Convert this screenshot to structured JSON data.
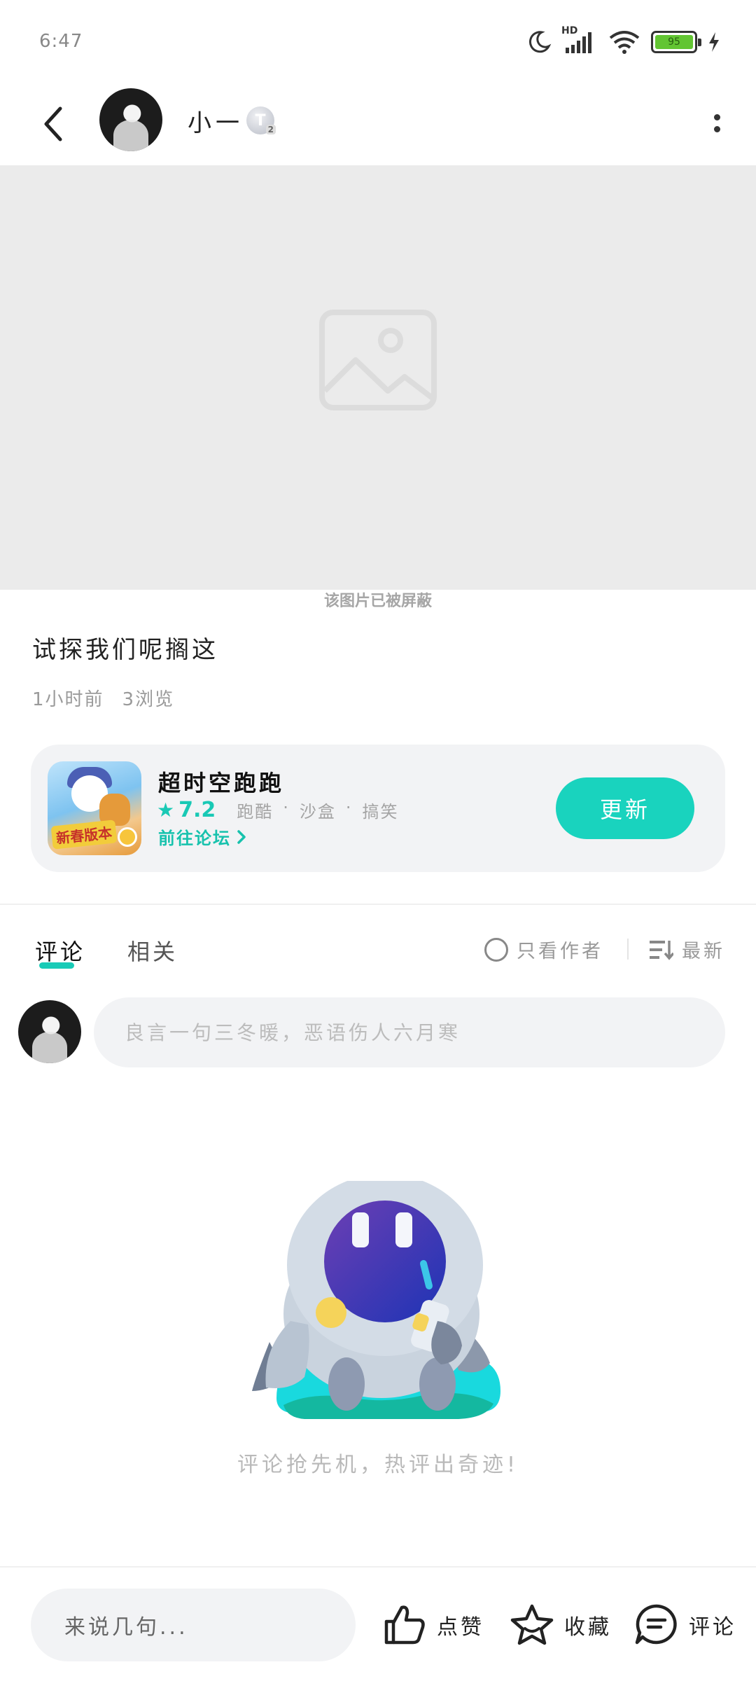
{
  "status_bar": {
    "time": "6:47",
    "network_label": "HD",
    "battery_level": "95"
  },
  "header": {
    "user_name": "小一",
    "level_badge": "T",
    "level_sub": "2"
  },
  "media": {
    "blocked_text": "该图片已被屏蔽"
  },
  "post": {
    "title": "试探我们呢搁这",
    "time_ago": "1小时前",
    "views": "3浏览"
  },
  "game_card": {
    "name": "超时空跑跑",
    "rating": "7.2",
    "tags": [
      "跑酷",
      "·",
      "沙盒",
      "·",
      "搞笑"
    ],
    "forum_link": "前往论坛",
    "update_button": "更新",
    "icon_badge": "新春版本"
  },
  "tabs": [
    {
      "label": "评论",
      "active": true
    },
    {
      "label": "相关",
      "active": false
    }
  ],
  "filters": {
    "author_only": "只看作者",
    "sort": "最新"
  },
  "comment_box": {
    "placeholder": "良言一句三冬暖，恶语伤人六月寒"
  },
  "empty_state": {
    "message": "评论抢先机，热评出奇迹!"
  },
  "bottom_bar": {
    "input_placeholder": "来说几句...",
    "like_label": "点赞",
    "favorite_label": "收藏",
    "comment_label": "评论"
  },
  "colors": {
    "accent": "#19d3be",
    "accent_text": "#17c2ad",
    "card_bg": "#f2f3f5",
    "blocked_bg": "#ebebeb"
  },
  "icons": [
    "back-arrow-icon",
    "more-vertical-icon",
    "image-placeholder-icon",
    "star-icon",
    "chevron-right-icon",
    "radio-icon",
    "sort-icon",
    "thumb-up-icon",
    "star-outline-icon",
    "comment-bubble-icon"
  ]
}
